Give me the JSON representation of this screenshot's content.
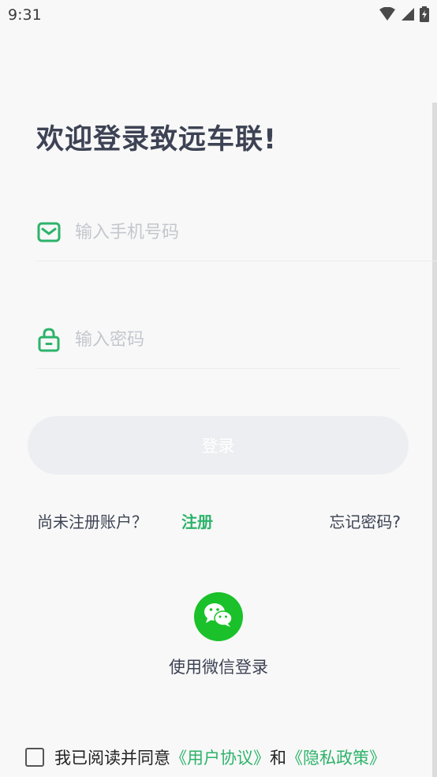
{
  "status_bar": {
    "time": "9:31"
  },
  "title": "欢迎登录致远车联!",
  "phone": {
    "placeholder": "输入手机号码",
    "value": ""
  },
  "password": {
    "placeholder": "输入密码",
    "value": ""
  },
  "login_button": "登录",
  "register": {
    "prompt": "尚未注册账户？",
    "link": "注册"
  },
  "forgot_password": "忘记密码?",
  "wechat_login": {
    "label": "使用微信登录"
  },
  "agreement": {
    "checked": false,
    "prefix": "我已阅读并同意",
    "user_agreement": "《用户协议》",
    "and": "和",
    "privacy_policy": "《隐私政策》"
  },
  "colors": {
    "accent": "#2db36a",
    "wechat": "#1ac12a",
    "button_disabled": "#eceef1",
    "text": "#3d4354"
  }
}
